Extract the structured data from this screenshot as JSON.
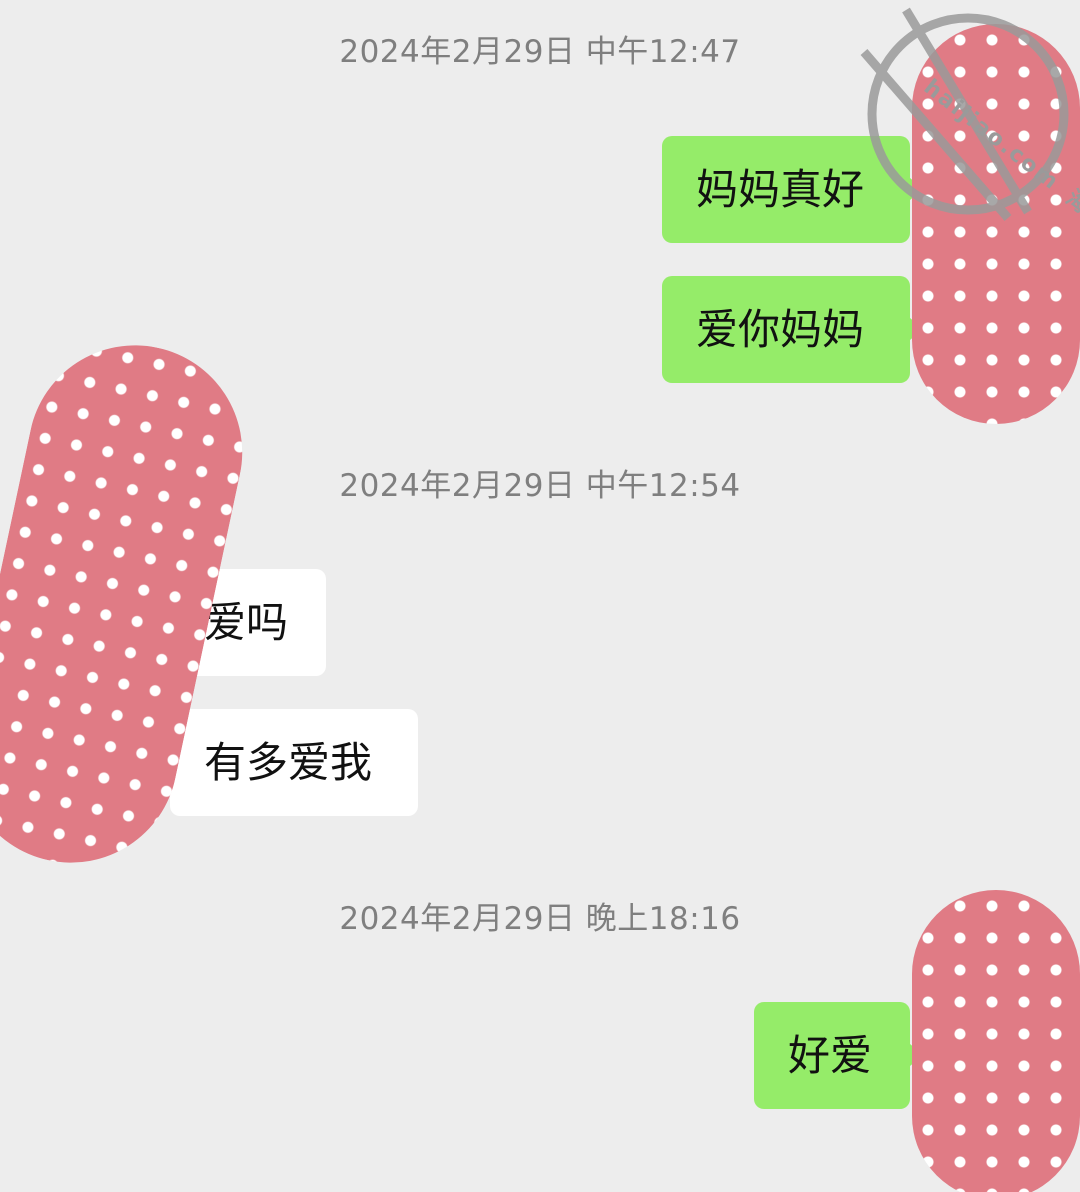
{
  "colors": {
    "background": "#ededed",
    "timestamp_text": "#7f7f7f",
    "outgoing_bubble": "#95ec69",
    "incoming_bubble": "#ffffff",
    "avatar_mask": "#e07b85"
  },
  "messages": [
    {
      "type": "timestamp",
      "text": "2024年2月29日 中午12:47"
    },
    {
      "type": "outgoing",
      "text": "妈妈真好"
    },
    {
      "type": "outgoing",
      "text": "爱你妈妈"
    },
    {
      "type": "timestamp",
      "text": "2024年2月29日 中午12:54"
    },
    {
      "type": "incoming",
      "text": "爱吗"
    },
    {
      "type": "incoming",
      "text": "有多爱我"
    },
    {
      "type": "timestamp",
      "text": "2024年2月29日 晚上18:16"
    },
    {
      "type": "outgoing",
      "text": "好爱"
    }
  ],
  "watermark": {
    "site_text": "haijiao.com",
    "label_text": "海角社区"
  }
}
